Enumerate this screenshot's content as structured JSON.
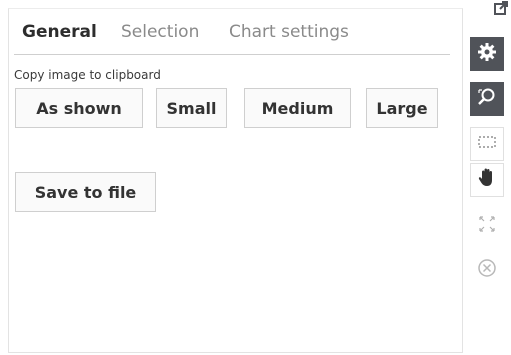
{
  "tabs": [
    {
      "label": "General",
      "active": true
    },
    {
      "label": "Selection",
      "active": false
    },
    {
      "label": "Chart settings",
      "active": false
    }
  ],
  "copy_section": {
    "label": "Copy image to clipboard",
    "buttons": [
      "As shown",
      "Small",
      "Medium",
      "Large"
    ]
  },
  "save_button": "Save to file",
  "toolbar": {
    "icons": [
      "popout-icon",
      "gear-icon",
      "zoom-icon",
      "select-icon",
      "pan-icon",
      "fit-icon",
      "close-icon"
    ],
    "dark_color": "#505359"
  },
  "colors": {
    "active_tab": "#2d2d2d",
    "inactive_tab": "#8a8a8a",
    "button_text": "#333333",
    "border": "#cfcfcf"
  }
}
